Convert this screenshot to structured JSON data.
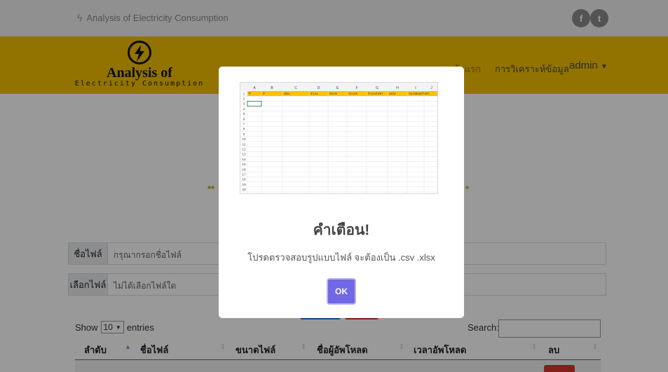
{
  "site": {
    "brand_text": "Analysis of Electricity Consumption",
    "social": [
      "facebook-icon",
      "twitter-icon"
    ]
  },
  "navbar": {
    "logo_title": "Analysis of",
    "logo_subtitle": "Electricity Consumption",
    "home": "หน้าแรก",
    "analysis": "การวิเคราะห์ข้อมูล",
    "user": "admin"
  },
  "form": {
    "filename_label": "ชื่อไฟล์",
    "filename_placeholder": "กรุณากรอกชื่อไฟล์",
    "choose_label": "เลือกไฟล์",
    "choose_value": "ไม่ได้เลือกไฟล์ใด"
  },
  "table": {
    "show_prefix": "Show",
    "show_value": "10",
    "show_suffix": "entries",
    "search_label": "Search:",
    "columns": [
      "ลำดับ",
      "ชื่อไฟล์",
      "ขนาดไฟล์",
      "ชื่อผู้อัพโหลด",
      "เวลาอัพโหลด",
      "ลบ"
    ]
  },
  "modal": {
    "title": "คำเตือน!",
    "message": "โปรดตรวจสอบรูปแบบไฟล์ จะต้องเป็น .csv .xlsx",
    "ok_label": "OK",
    "spreadsheet": {
      "columns": [
        "A",
        "B",
        "C",
        "D",
        "E",
        "F",
        "G",
        "H",
        "I",
        "J"
      ],
      "headers": [
        "ปี",
        "ปี",
        "เดือน",
        "อำเภอ",
        "จังหวัด",
        "ประเภท",
        "จำนวนไฟฟ้า",
        "หน่วย",
        "ขนาดมิเตอร์ไฟฟ้า",
        ""
      ],
      "row_count": 20
    }
  },
  "colors": {
    "navbar": "#f4c000",
    "modal_button": "#7267e6",
    "header_row": "#ffc000"
  }
}
